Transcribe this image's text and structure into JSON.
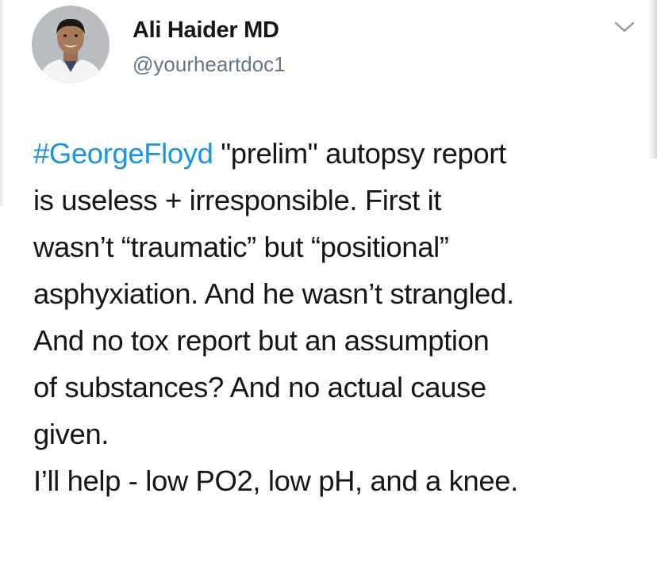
{
  "author": {
    "name": "Ali Haider MD",
    "handle": "@yourheartdoc1",
    "avatar_icon": "profile-photo"
  },
  "menu": {
    "icon": "chevron-down-icon"
  },
  "tweet": {
    "hashtag": "#GeorgeFloyd",
    "line1_rest": " \"prelim\" autopsy report",
    "lines": [
      "is useless + irresponsible. First it",
      "wasn’t “traumatic” but “positional”",
      "asphyxiation. And he wasn’t strangled.",
      "And no tox report but an assumption",
      "of substances? And no actual cause",
      "given.",
      "I’ll help - low PO2, low pH, and a knee."
    ]
  },
  "colors": {
    "link": "#1b95e0",
    "secondary": "#657786",
    "text": "#14171a"
  }
}
